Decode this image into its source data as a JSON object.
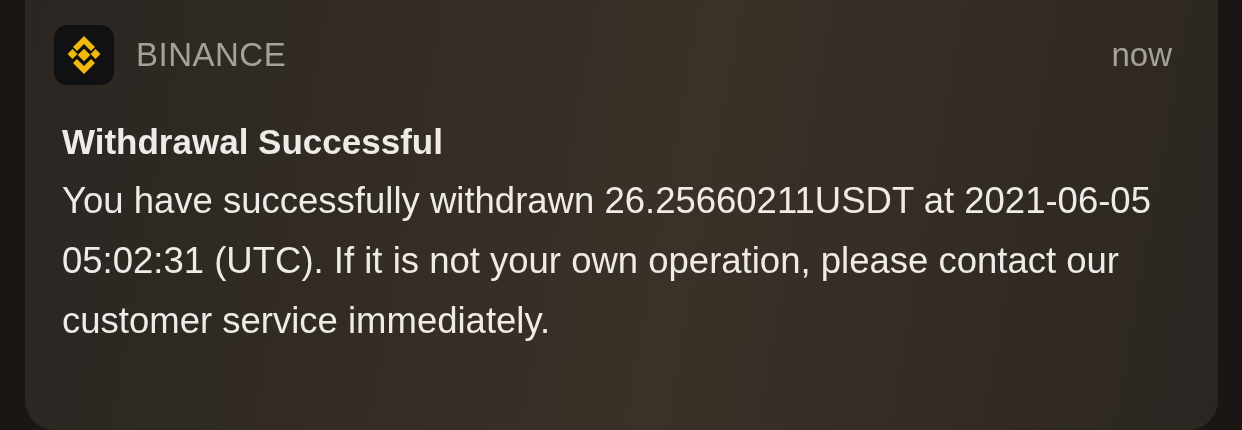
{
  "notification": {
    "app_name": "BINANCE",
    "time": "now",
    "title": "Withdrawal Successful",
    "body": "You have successfully withdrawn 26.25660211USDT at 2021-06-05 05:02:31 (UTC). If it is not your own operation, please contact our customer service immediately."
  }
}
